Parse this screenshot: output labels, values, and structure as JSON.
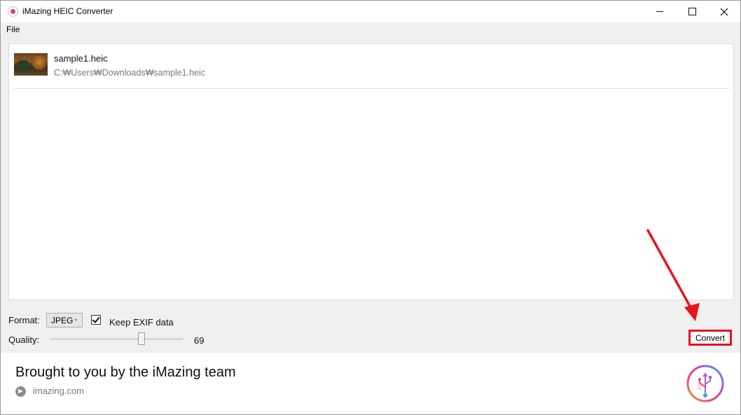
{
  "window": {
    "title": "iMazing HEIC Converter"
  },
  "menu": {
    "file_label": "File"
  },
  "files": [
    {
      "name": "sample1.heic",
      "path": "C:₩Users₩Downloads₩sample1.heic"
    }
  ],
  "options": {
    "format_label": "Format:",
    "format_value": "JPEG",
    "keep_exif_label": "Keep EXIF data",
    "keep_exif_checked": true,
    "quality_label": "Quality:",
    "quality_value": "69",
    "quality_min": 0,
    "quality_max": 100
  },
  "actions": {
    "convert_label": "Convert"
  },
  "footer": {
    "promo_text": "Brought to you by the iMazing team",
    "link_text": "imazing.com"
  },
  "colors": {
    "highlight": "#e8141c"
  },
  "icons": {
    "app": "imazing-app-icon",
    "link": "arrow-right-circle-icon",
    "logo": "imazing-usb-logo"
  }
}
